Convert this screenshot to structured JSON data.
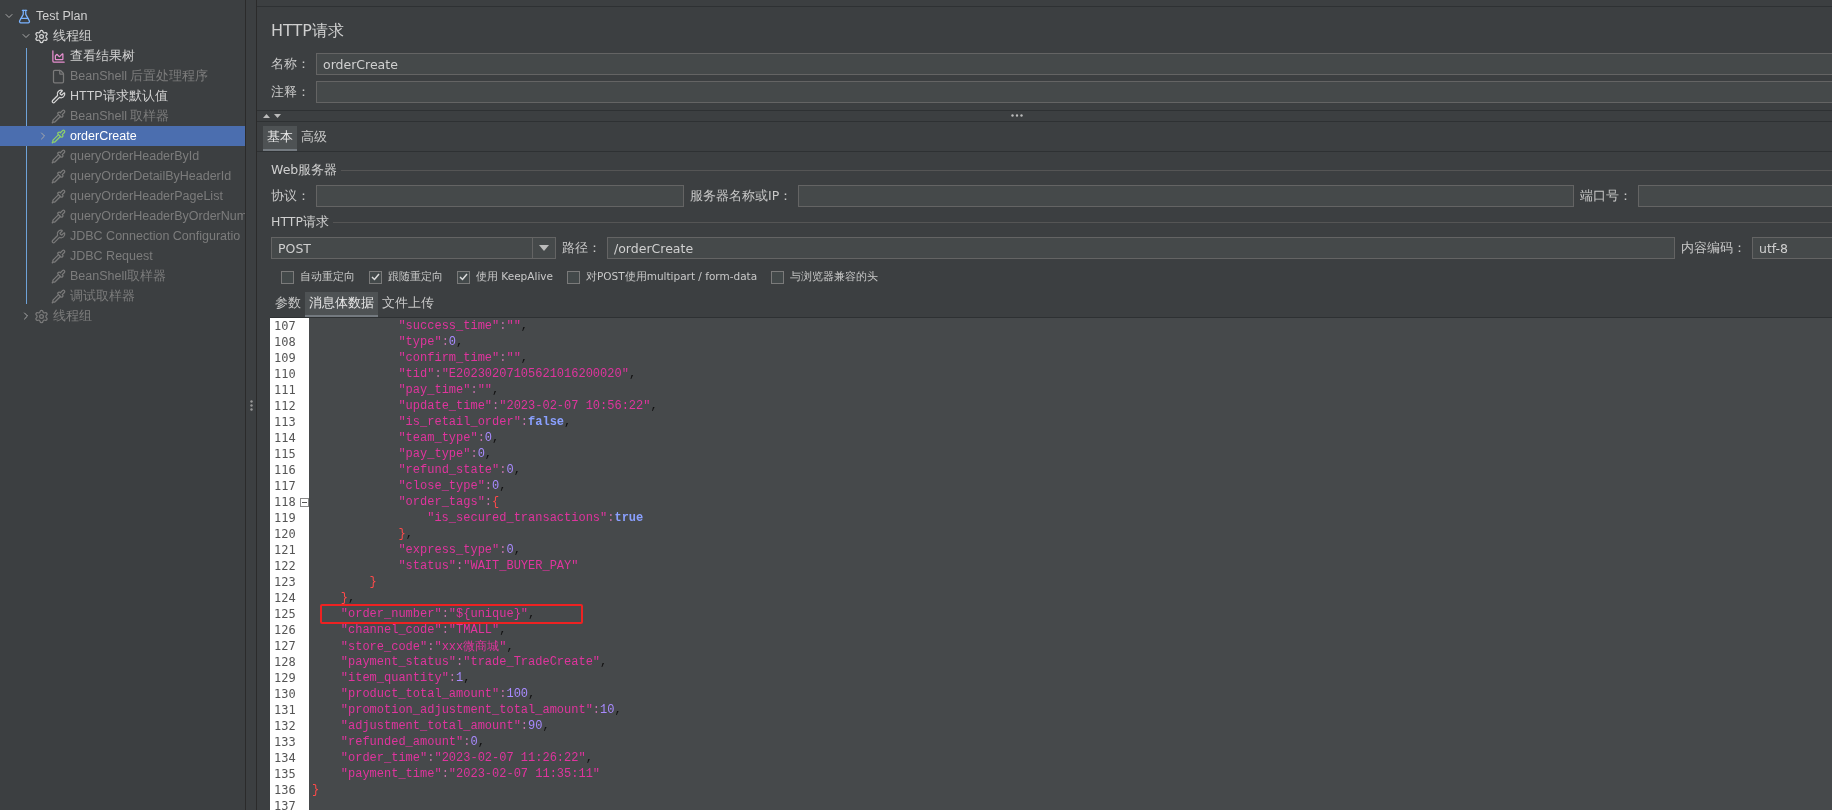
{
  "tree": [
    {
      "label": "Test Plan",
      "kind": "plan",
      "disabled": false,
      "selected": false,
      "expanded": true,
      "children": [
        {
          "label": "线程组",
          "kind": "group",
          "disabled": false,
          "selected": false,
          "expanded": true,
          "children": [
            {
              "label": "查看结果树",
              "kind": "listener",
              "disabled": false,
              "selected": false
            },
            {
              "label": "BeanShell 后置处理程序",
              "kind": "post",
              "disabled": true,
              "selected": false
            },
            {
              "label": "HTTP请求默认值",
              "kind": "config",
              "disabled": false,
              "selected": false
            },
            {
              "label": "BeanShell 取样器",
              "kind": "sampler",
              "disabled": true,
              "selected": false
            },
            {
              "label": "orderCreate",
              "kind": "sampler",
              "disabled": false,
              "selected": true,
              "expanded": false
            },
            {
              "label": "queryOrderHeaderById",
              "kind": "sampler",
              "disabled": true,
              "selected": false
            },
            {
              "label": "queryOrderDetailByHeaderId",
              "kind": "sampler",
              "disabled": true,
              "selected": false
            },
            {
              "label": "queryOrderHeaderPageList",
              "kind": "sampler",
              "disabled": true,
              "selected": false
            },
            {
              "label": "queryOrderHeaderByOrderNum",
              "kind": "sampler",
              "disabled": true,
              "selected": false
            },
            {
              "label": "JDBC Connection Configuratio",
              "kind": "config",
              "disabled": true,
              "selected": false
            },
            {
              "label": "JDBC Request",
              "kind": "sampler",
              "disabled": true,
              "selected": false
            },
            {
              "label": "BeanShell取样器",
              "kind": "sampler",
              "disabled": true,
              "selected": false
            },
            {
              "label": "调试取样器",
              "kind": "sampler",
              "disabled": true,
              "selected": false
            }
          ]
        },
        {
          "label": "线程组",
          "kind": "group",
          "disabled": true,
          "selected": false,
          "expanded": false
        }
      ]
    }
  ],
  "panel": {
    "title": "HTTP请求",
    "name": {
      "label": "名称：",
      "value": "orderCreate"
    },
    "comment": {
      "label": "注释："
    },
    "tabs": [
      {
        "label": "基本",
        "selected": true
      },
      {
        "label": "高级",
        "selected": false
      }
    ],
    "web_server": {
      "title": "Web服务器",
      "protocol": {
        "label": "协议："
      },
      "server": {
        "label": "服务器名称或IP："
      },
      "port": {
        "label": "端口号："
      }
    },
    "http_request": {
      "title": "HTTP请求",
      "method": "POST",
      "path": {
        "label": "路径：",
        "value": "/orderCreate"
      },
      "encoding": {
        "label": "内容编码：",
        "value": "utf-8"
      }
    },
    "options": [
      {
        "label": "自动重定向",
        "checked": false
      },
      {
        "label": "跟随重定向",
        "checked": true
      },
      {
        "label": "使用 KeepAlive",
        "checked": true
      },
      {
        "label": "对POST使用multipart / form-data",
        "checked": false
      },
      {
        "label": "与浏览器兼容的头",
        "checked": false
      }
    ],
    "body_tabs": [
      {
        "label": "参数",
        "selected": false
      },
      {
        "label": "消息体数据",
        "selected": true
      },
      {
        "label": "文件上传",
        "selected": false
      }
    ],
    "code": [
      {
        "no": "107",
        "text": "            \"success_time\":\"\",",
        "fold": false,
        "boxed": false
      },
      {
        "no": "108",
        "text": "            \"type\":0,",
        "fold": false,
        "boxed": false
      },
      {
        "no": "109",
        "text": "            \"confirm_time\":\"\",",
        "fold": false,
        "boxed": false
      },
      {
        "no": "110",
        "text": "            \"tid\":\"E20230207105621016200020\",",
        "fold": false,
        "boxed": false
      },
      {
        "no": "111",
        "text": "            \"pay_time\":\"\",",
        "fold": false,
        "boxed": false
      },
      {
        "no": "112",
        "text": "            \"update_time\":\"2023-02-07 10:56:22\",",
        "fold": false,
        "boxed": false
      },
      {
        "no": "113",
        "text": "            \"is_retail_order\":false,",
        "fold": false,
        "boxed": false
      },
      {
        "no": "114",
        "text": "            \"team_type\":0,",
        "fold": false,
        "boxed": false
      },
      {
        "no": "115",
        "text": "            \"pay_type\":0,",
        "fold": false,
        "boxed": false
      },
      {
        "no": "116",
        "text": "            \"refund_state\":0,",
        "fold": false,
        "boxed": false
      },
      {
        "no": "117",
        "text": "            \"close_type\":0,",
        "fold": false,
        "boxed": false
      },
      {
        "no": "118",
        "text": "            \"order_tags\":{",
        "fold": true,
        "boxed": false
      },
      {
        "no": "119",
        "text": "                \"is_secured_transactions\":true",
        "fold": false,
        "boxed": false
      },
      {
        "no": "120",
        "text": "            },",
        "fold": false,
        "boxed": false
      },
      {
        "no": "121",
        "text": "            \"express_type\":0,",
        "fold": false,
        "boxed": false
      },
      {
        "no": "122",
        "text": "            \"status\":\"WAIT_BUYER_PAY\"",
        "fold": false,
        "boxed": false
      },
      {
        "no": "123",
        "text": "        }",
        "fold": false,
        "boxed": false
      },
      {
        "no": "124",
        "text": "    },",
        "fold": false,
        "boxed": false
      },
      {
        "no": "125",
        "text": "    \"order_number\":\"${unique}\",",
        "fold": false,
        "boxed": true
      },
      {
        "no": "126",
        "text": "    \"channel_code\":\"TMALL\",",
        "fold": false,
        "boxed": false
      },
      {
        "no": "127",
        "text": "    \"store_code\":\"xxx微商城\",",
        "fold": false,
        "boxed": false
      },
      {
        "no": "128",
        "text": "    \"payment_status\":\"trade_TradeCreate\",",
        "fold": false,
        "boxed": false
      },
      {
        "no": "129",
        "text": "    \"item_quantity\":1,",
        "fold": false,
        "boxed": false
      },
      {
        "no": "130",
        "text": "    \"product_total_amount\":100,",
        "fold": false,
        "boxed": false
      },
      {
        "no": "131",
        "text": "    \"promotion_adjustment_total_amount\":10,",
        "fold": false,
        "boxed": false
      },
      {
        "no": "132",
        "text": "    \"adjustment_total_amount\":90,",
        "fold": false,
        "boxed": false
      },
      {
        "no": "133",
        "text": "    \"refunded_amount\":0,",
        "fold": false,
        "boxed": false
      },
      {
        "no": "134",
        "text": "    \"order_time\":\"2023-02-07 11:26:22\",",
        "fold": false,
        "boxed": false
      },
      {
        "no": "135",
        "text": "    \"payment_time\":\"2023-02-07 11:35:11\"",
        "fold": false,
        "boxed": false
      },
      {
        "no": "136",
        "text": "}",
        "fold": false,
        "boxed": false
      },
      {
        "no": "137",
        "fold": false,
        "boxed": false
      }
    ]
  }
}
